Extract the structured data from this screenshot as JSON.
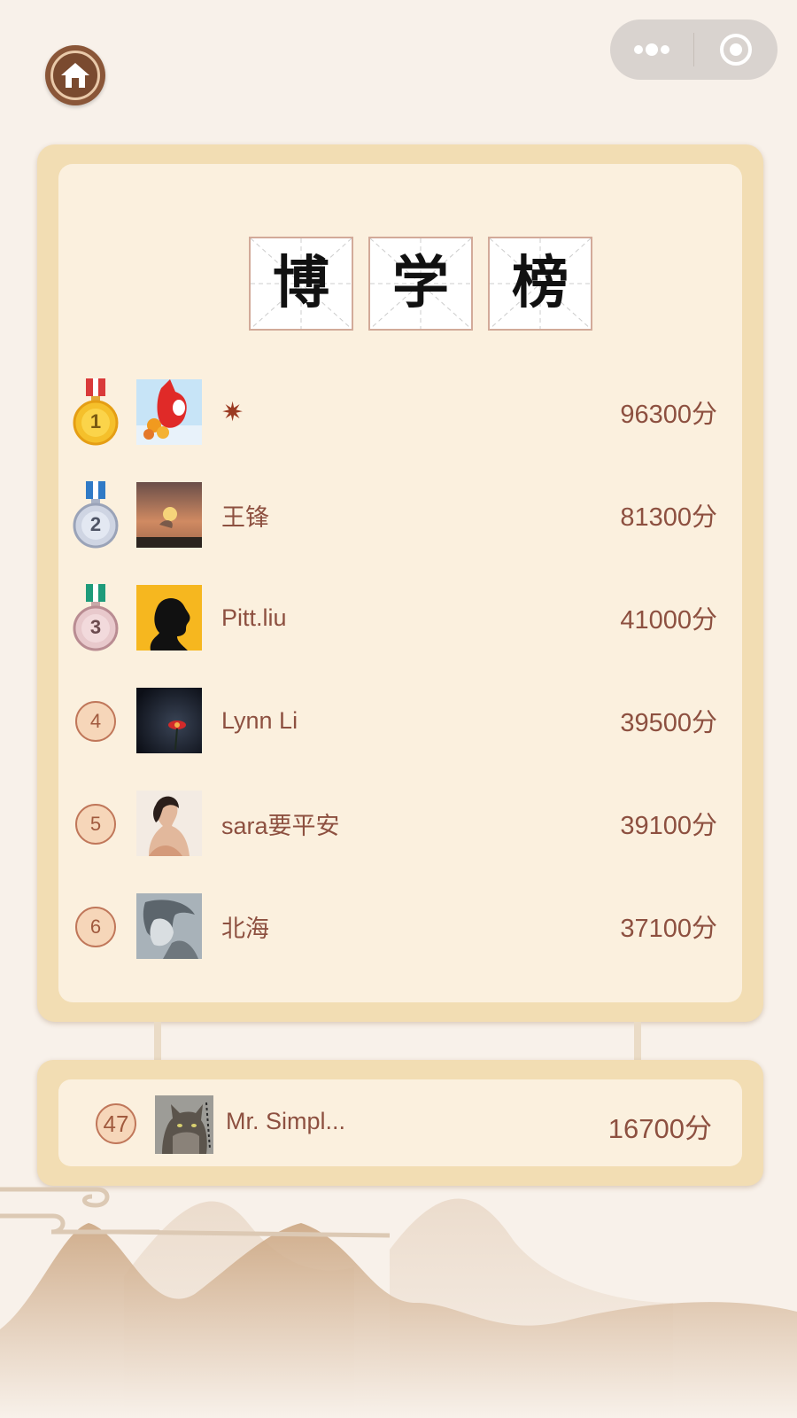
{
  "header": {
    "home_icon": "home-icon",
    "capsule": {
      "more_icon": "more-dots-icon",
      "close_icon": "target-close-icon"
    }
  },
  "board": {
    "title_chars": [
      "博",
      "学",
      "榜"
    ],
    "rows": [
      {
        "rank": "1",
        "badge": "gold-medal-icon",
        "avatar": "red-fox-avatar",
        "name": "✷",
        "score": "96300分"
      },
      {
        "rank": "2",
        "badge": "silver-medal-icon",
        "avatar": "sunset-avatar",
        "name": "王锋",
        "score": "81300分"
      },
      {
        "rank": "3",
        "badge": "bronze-medal-icon",
        "avatar": "silhouette-avatar",
        "name": "Pitt.liu",
        "score": "41000分"
      },
      {
        "rank": "4",
        "badge": "number-circle",
        "avatar": "dark-flower-avatar",
        "name": "Lynn Li",
        "score": "39500分"
      },
      {
        "rank": "5",
        "badge": "number-circle",
        "avatar": "woman-portrait-avatar",
        "name": "sara要平安",
        "score": "39100分"
      },
      {
        "rank": "6",
        "badge": "number-circle",
        "avatar": "sketch-portrait-avatar",
        "name": "北海",
        "score": "37100分"
      }
    ]
  },
  "me": {
    "rank": "47",
    "avatar": "cat-avatar",
    "name": "Mr. Simpl...",
    "score": "16700分"
  },
  "colors": {
    "frame": "#f2ddb3",
    "panel": "#fbf0de",
    "text": "#8d5040",
    "background": "#f8f1ea"
  }
}
